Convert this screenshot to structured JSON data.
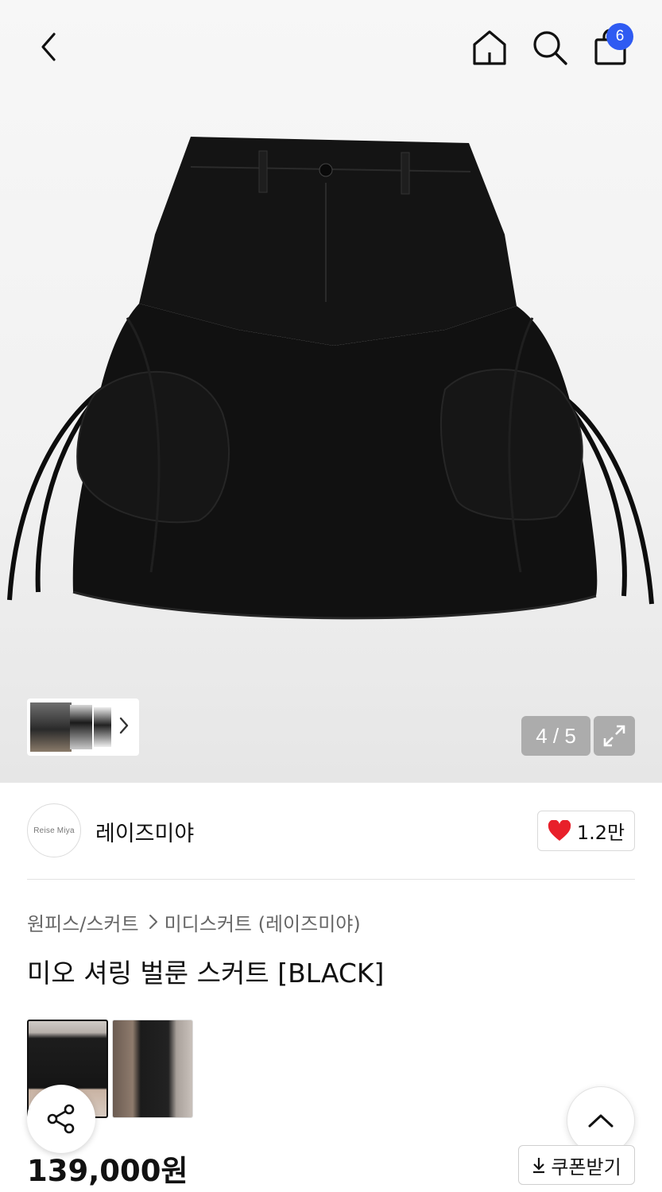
{
  "header": {
    "cart_count": "6"
  },
  "gallery": {
    "counter": "4 / 5"
  },
  "brand": {
    "logo_text": "Reise Miya",
    "name": "레이즈미야",
    "likes": "1.2만"
  },
  "breadcrumb": {
    "category": "원피스/스커트",
    "subcategory": "미디스커트 (레이즈미야)"
  },
  "product": {
    "title": "미오 셔링 벌룬 스커트 [BLACK]",
    "price": "139,000원",
    "coupon_label": "쿠폰받기"
  },
  "colors": {
    "accent_blue": "#2f5bf2",
    "heart_red": "#e8202a"
  }
}
